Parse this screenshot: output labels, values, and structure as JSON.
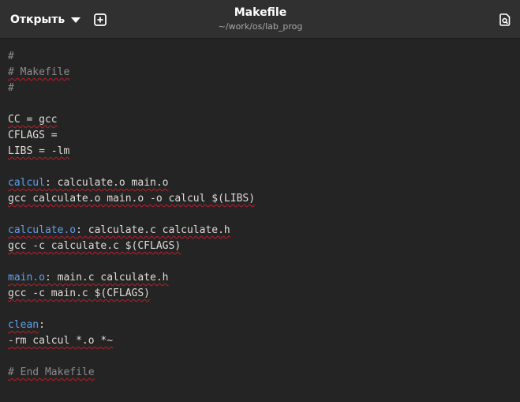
{
  "header": {
    "open_label": "Открыть",
    "title": "Makefile",
    "path": "~/work/os/lab_prog",
    "icons": {
      "open_dropdown": "chevron-down-icon",
      "new_tab": "new-tab-icon",
      "save": "save-document-icon"
    }
  },
  "editor": {
    "colors": {
      "background": "#242424",
      "text": "#deddda",
      "comment": "#8c8c8c",
      "target": "#62a0ea",
      "spell_underline": "#c01c28"
    },
    "lines": {
      "l1": "#",
      "l2": "# Makefile",
      "l3": "#",
      "l5": "CC = gcc",
      "l6": "CFLAGS =",
      "l7": "LIBS = -lm",
      "l9_target": "calcul",
      "l9_rest": ": calculate.o main.o",
      "l10": "gcc calculate.o main.o -o calcul $(LIBS)",
      "l12_target": "calculate.o",
      "l12_rest": ": calculate.c calculate.h",
      "l13": "gcc -c calculate.c $(CFLAGS)",
      "l15_target": "main.o",
      "l15_rest": ": main.c calculate.h",
      "l16": "gcc -c main.c $(CFLAGS)",
      "l18_target": "clean",
      "l18_rest": ":",
      "l19": "-rm calcul *.o *~",
      "l21": "# End Makefile"
    }
  }
}
